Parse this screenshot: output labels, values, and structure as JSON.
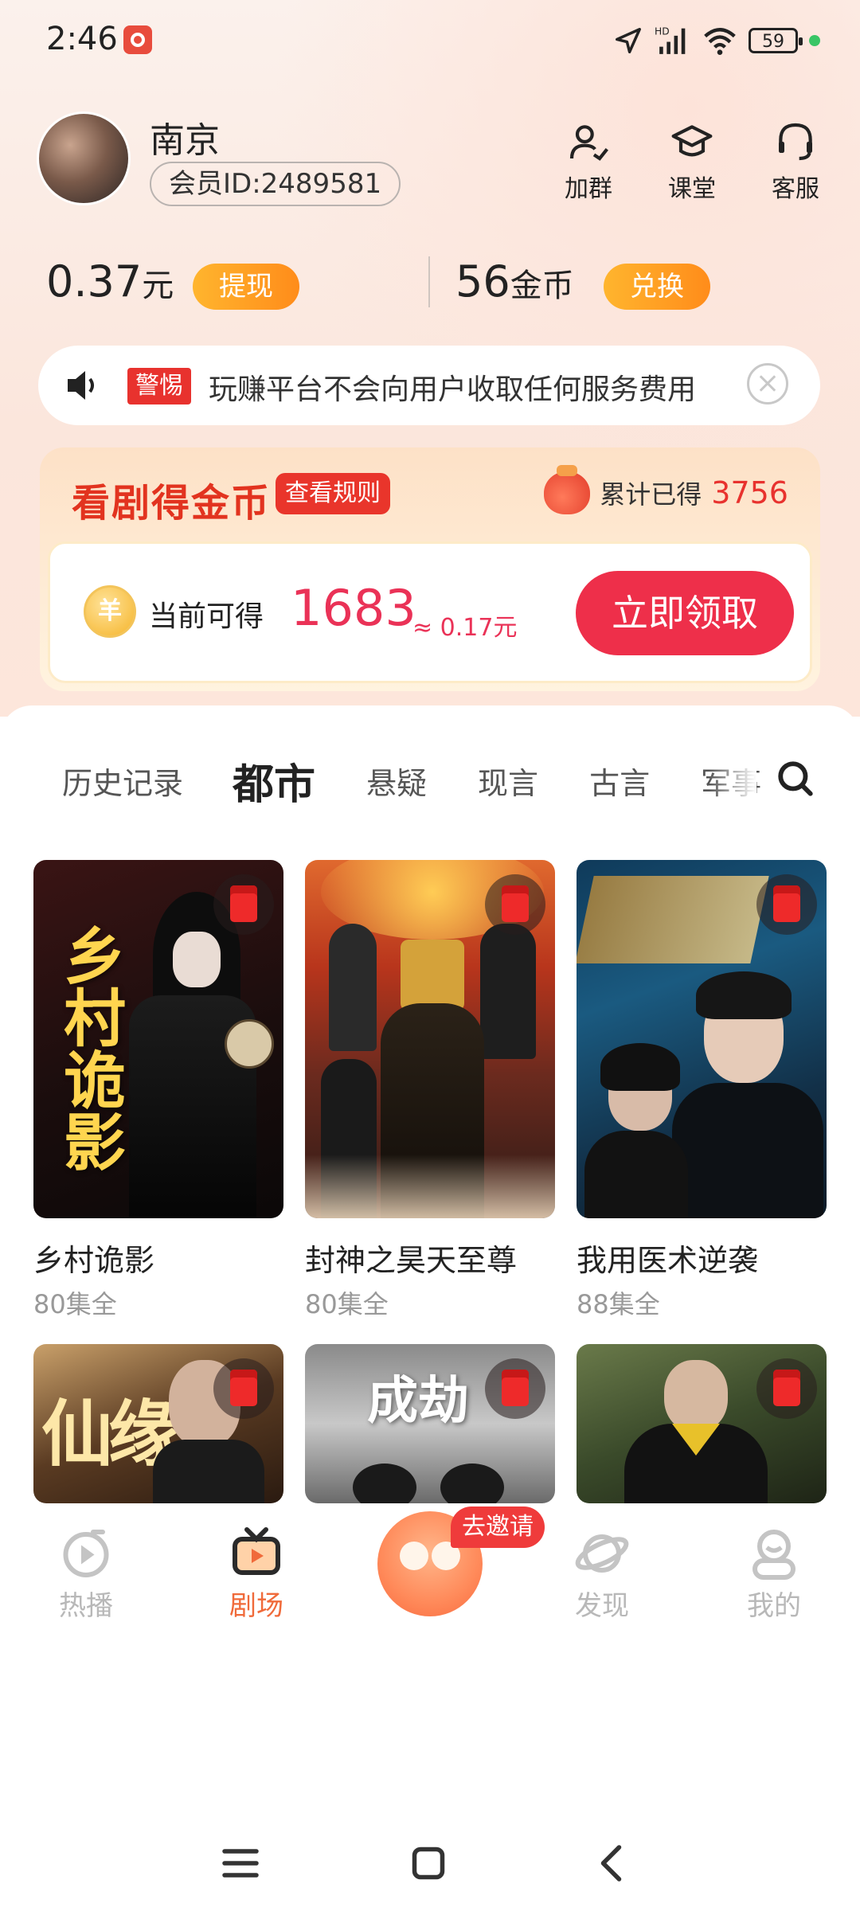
{
  "status_bar": {
    "time": "2:46",
    "battery": "59",
    "network": "HD"
  },
  "profile": {
    "username": "南京",
    "member_id": "会员ID:2489581"
  },
  "top_actions": [
    {
      "label": "加群",
      "icon": "user-group-icon"
    },
    {
      "label": "课堂",
      "icon": "graduation-cap-icon"
    },
    {
      "label": "客服",
      "icon": "headset-icon"
    }
  ],
  "balance": {
    "cash_value": "0.37",
    "cash_unit": "元",
    "withdraw_label": "提现",
    "coin_value": "56",
    "coin_unit": "金币",
    "exchange_label": "兑换"
  },
  "notice": {
    "tag": "警惕",
    "text": "玩赚平台不会向用户收取任何服务费用"
  },
  "reward": {
    "title": "看剧得金币",
    "rule_label": "查看规则",
    "total_label": "累计已得",
    "total_value": "3756",
    "coin_symbol": "羊",
    "current_label": "当前可得",
    "current_value": "1683",
    "approx": "≈ 0.17元",
    "claim_label": "立即领取"
  },
  "categories": [
    "历史记录",
    "都市",
    "悬疑",
    "现言",
    "古言",
    "军事"
  ],
  "active_category": "都市",
  "dramas": [
    {
      "name": "乡村诡影",
      "count": "80集全",
      "poster_text": "乡村诡影"
    },
    {
      "name": "封神之昊天至尊",
      "count": "80集全",
      "poster_text": ""
    },
    {
      "name": "我用医术逆袭",
      "count": "88集全",
      "poster_text": ""
    },
    {
      "name": "",
      "count": "",
      "poster_text": "仙缘"
    },
    {
      "name": "",
      "count": "",
      "poster_text": "成劫"
    },
    {
      "name": "",
      "count": "",
      "poster_text": ""
    }
  ],
  "bottom_nav": [
    {
      "label": "热播",
      "icon": "play-circle-icon"
    },
    {
      "label": "剧场",
      "icon": "tv-icon"
    },
    {
      "label": "去邀请",
      "icon": "invite-icon"
    },
    {
      "label": "发现",
      "icon": "planet-icon"
    },
    {
      "label": "我的",
      "icon": "profile-icon"
    }
  ],
  "colors": {
    "accent": "#ee2f4a",
    "orange": "#f06a3a",
    "coin": "#ffb52e"
  }
}
